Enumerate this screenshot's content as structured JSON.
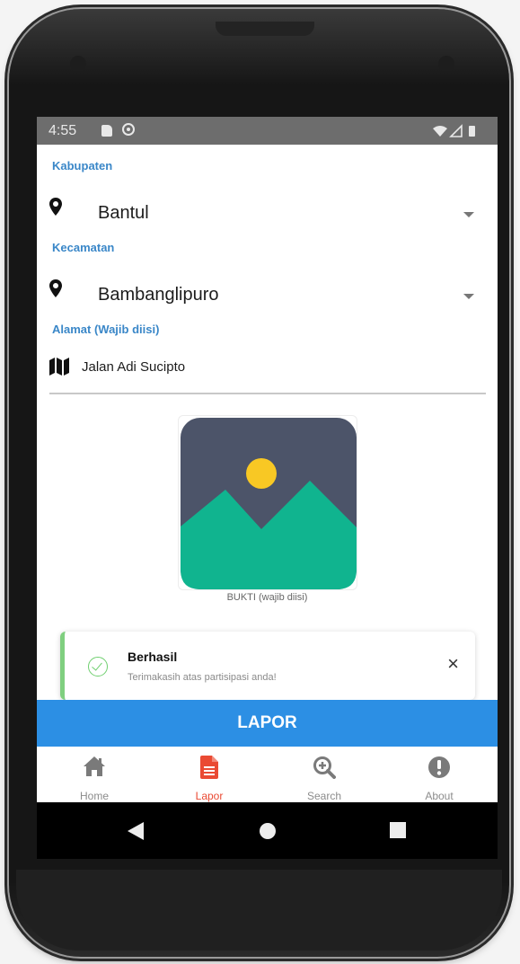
{
  "status_bar": {
    "time": "4:55"
  },
  "form": {
    "kabupaten": {
      "label": "Kabupaten",
      "value": "Bantul",
      "icon": "map-pin-icon"
    },
    "kecamatan": {
      "label": "Kecamatan",
      "value": "Bambanglipuro",
      "icon": "map-pin-icon"
    },
    "alamat": {
      "label": "Alamat (Wajib diisi)",
      "value": "Jalan Adi Sucipto",
      "icon": "map-icon"
    },
    "image": {
      "caption": "BUKTI (wajib diisi)",
      "icon": "image-placeholder-icon"
    }
  },
  "toast": {
    "title": "Berhasil",
    "message": "Terimakasih atas partisipasi anda!",
    "close": "×",
    "accent_color": "#7fcf7f"
  },
  "submit": {
    "label": "LAPOR",
    "color": "#2c8fe4"
  },
  "bottom_nav": {
    "items": [
      {
        "label": "Home",
        "icon": "home-icon",
        "active": false
      },
      {
        "label": "Lapor",
        "icon": "document-icon",
        "active": true
      },
      {
        "label": "Search",
        "icon": "zoom-in-icon",
        "active": false
      },
      {
        "label": "About",
        "icon": "alert-circle-icon",
        "active": false
      }
    ],
    "active_color": "#ea4a33",
    "inactive_color": "#8c8c8c"
  },
  "android_nav": {
    "buttons": [
      "back-icon",
      "home-circle-icon",
      "recents-icon"
    ]
  },
  "colors": {
    "label_blue": "#3a87c8"
  }
}
